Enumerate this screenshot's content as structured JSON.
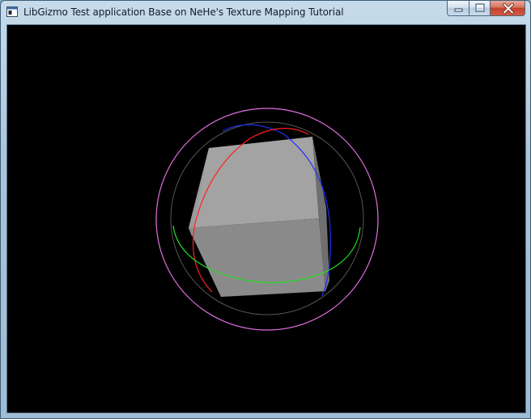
{
  "window": {
    "title": "LibGizmo Test application Base on NeHe's Texture Mapping Tutorial",
    "icon": "app-window-icon"
  },
  "caption_buttons": {
    "minimize_icon": "minimize-icon",
    "maximize_icon": "maximize-icon",
    "close_icon": "close-icon"
  },
  "scene": {
    "background_color": "#000000",
    "cube_colors": {
      "front": "#8a8a8a",
      "top": "#a3a3a3",
      "side": "#6f6f6f",
      "left": "#9a9a9a"
    },
    "gizmo_colors": {
      "outer_ring": "#e070e0",
      "inner_ring": "#555555",
      "x_axis_ring": "#ff2020",
      "y_axis_ring": "#20e020",
      "z_axis_ring": "#2030ff"
    }
  }
}
